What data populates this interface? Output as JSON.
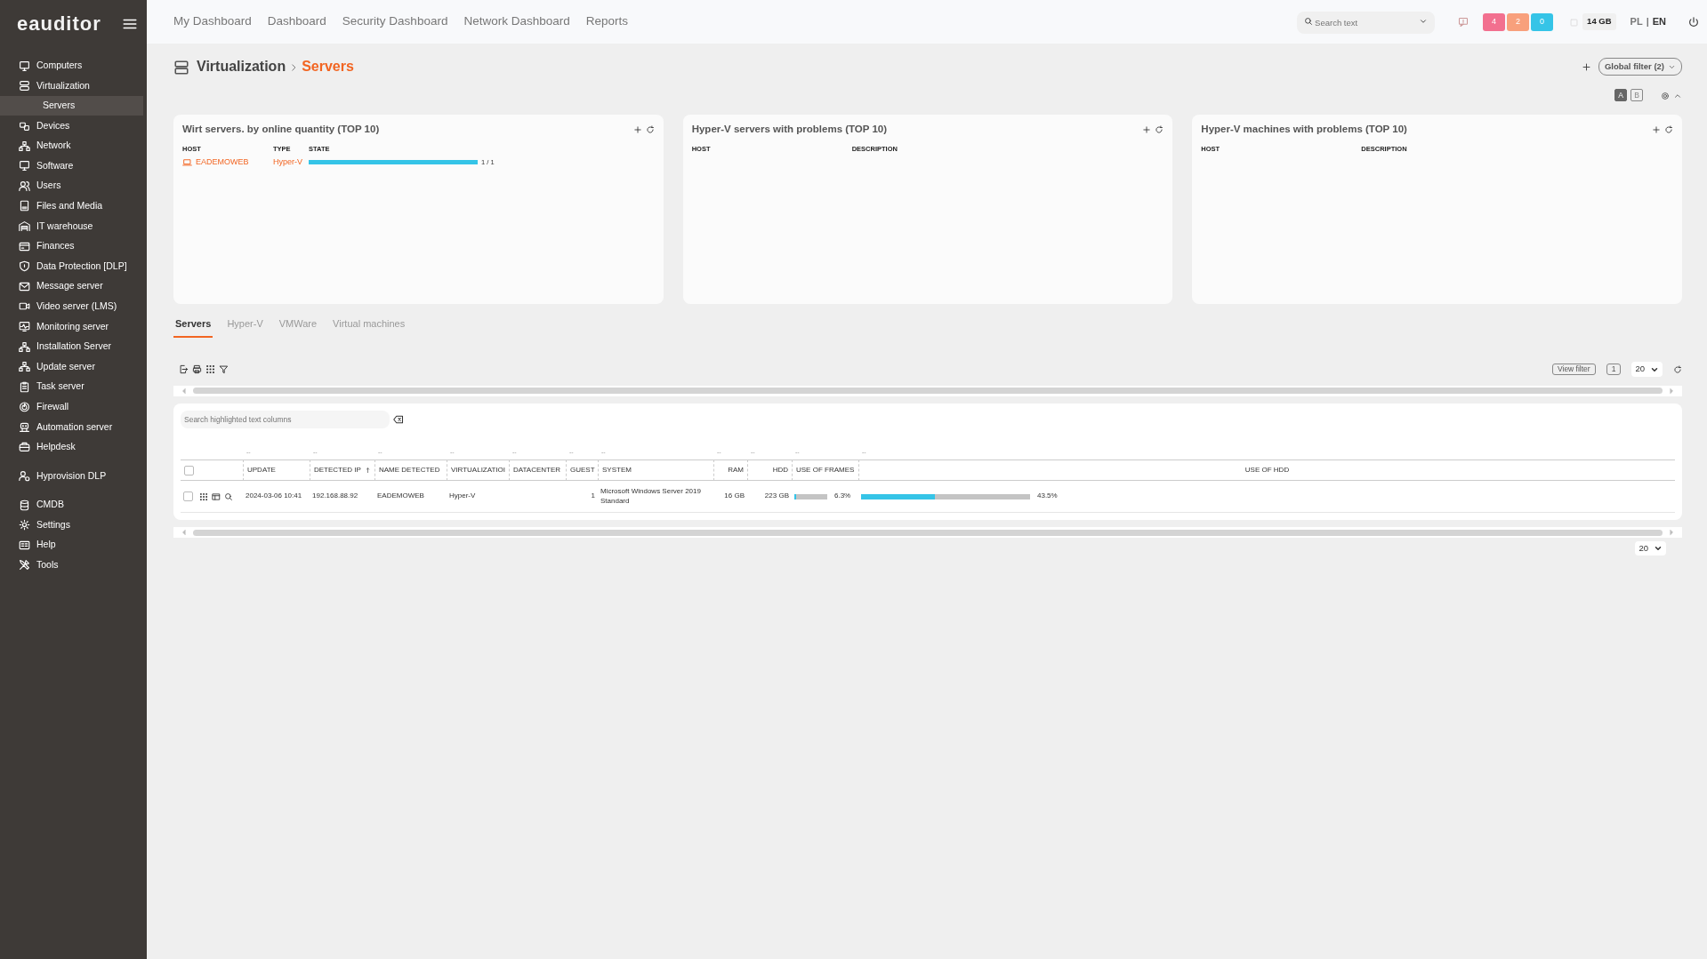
{
  "sidebar": {
    "logo": "eauditor",
    "sections": [
      {
        "items": [
          {
            "label": "Computers"
          },
          {
            "label": "Virtualization",
            "children": [
              {
                "label": "Servers",
                "selected": true
              }
            ]
          },
          {
            "label": "Devices"
          },
          {
            "label": "Network"
          },
          {
            "label": "Software"
          },
          {
            "label": "Users"
          },
          {
            "label": "Files and Media"
          },
          {
            "label": "IT warehouse"
          },
          {
            "label": "Finances"
          },
          {
            "label": "Data Protection [DLP]"
          },
          {
            "label": "Message server"
          },
          {
            "label": "Video server (LMS)"
          },
          {
            "label": "Monitoring server"
          },
          {
            "label": "Installation Server"
          },
          {
            "label": "Update server"
          },
          {
            "label": "Task server"
          },
          {
            "label": "Firewall"
          },
          {
            "label": "Automation server"
          },
          {
            "label": "Helpdesk"
          }
        ]
      },
      {
        "items": [
          {
            "label": "Hyprovision DLP"
          }
        ]
      },
      {
        "items": [
          {
            "label": "CMDB"
          },
          {
            "label": "Settings"
          },
          {
            "label": "Help"
          },
          {
            "label": "Tools"
          }
        ]
      }
    ]
  },
  "top_nav": {
    "links": [
      "My Dashboard",
      "Dashboard",
      "Security Dashboard",
      "Network Dashboard",
      "Reports"
    ],
    "search": {
      "placeholder": "Search text"
    },
    "alerts": [
      {
        "count": "4",
        "color": "#f2708f"
      },
      {
        "count": "2",
        "color": "#f8a07c"
      },
      {
        "count": "0",
        "color": "#35c4e7"
      }
    ],
    "memory": "14 GB",
    "languages": [
      {
        "code": "PL",
        "selected": false
      },
      {
        "code": "EN",
        "selected": true
      }
    ],
    "language_separator": "|"
  },
  "breadcrumb": [
    "Virtualization",
    "Servers"
  ],
  "global_filter": "Global filter (2)",
  "layout_toggle": [
    {
      "label": "A",
      "selected": true
    },
    {
      "label": "B",
      "selected": false
    }
  ],
  "widgets": [
    {
      "title": "Wirt servers. by online quantity (TOP 10)",
      "columns": [
        "HOST",
        "TYPE",
        "STATE"
      ],
      "rows": [
        {
          "host": "EADEMOWEB",
          "type": "Hyper-V",
          "level": 1.0,
          "reading": "1 / 1"
        }
      ]
    },
    {
      "title": "Hyper-V servers with problems (TOP 10)",
      "columns": [
        "HOST",
        "DESCRIPTION"
      ]
    },
    {
      "title": "Hyper-V machines with problems (TOP 10)",
      "columns": [
        "HOST",
        "DESCRIPTION"
      ]
    }
  ],
  "tabs": [
    {
      "label": "Servers",
      "selected": true
    },
    {
      "label": "Hyper-V",
      "selected": false
    },
    {
      "label": "VMWare",
      "selected": false
    },
    {
      "label": "Virtual machines",
      "selected": false
    }
  ],
  "toolbar": {
    "view_filter": "View filter",
    "page": "1",
    "page_size": "20"
  },
  "table": {
    "search": {
      "placeholder": "Search highlighted text columns"
    },
    "header_checked": false,
    "columns": [
      {
        "label": "UPDATE",
        "filter": "--",
        "sorted": false
      },
      {
        "label": "DETECTED IP",
        "filter": "--",
        "sorted": true
      },
      {
        "label": "NAME DETECTED",
        "filter": "--",
        "sorted": false
      },
      {
        "label": "VIRTUALIZATIOI",
        "filter": "--",
        "sorted": false
      },
      {
        "label": "DATACENTER",
        "filter": "--",
        "sorted": false
      },
      {
        "label": "GUEST",
        "filter": "--",
        "sorted": false
      },
      {
        "label": "SYSTEM",
        "filter": "--",
        "sorted": false
      },
      {
        "label": "RAM",
        "filter": "--",
        "sorted": false
      },
      {
        "label": "HDD",
        "filter": "--",
        "sorted": false
      },
      {
        "label": "USE OF FRAMES",
        "filter": "--",
        "sorted": false
      },
      {
        "label": "USE OF HDD",
        "filter": "--",
        "sorted": false
      }
    ],
    "rows": [
      {
        "checked": false,
        "cells": [
          "2024-03-06 10:41",
          "192.168.88.92",
          "EADEMOWEB",
          "Hyper-V",
          "",
          "1",
          "Microsoft Windows Server 2019 Standard",
          "16 GB",
          "223 GB"
        ],
        "frames": {
          "level": 0.063,
          "reading": "6.3%"
        },
        "hdd": {
          "level": 0.435,
          "reading": "43.5%"
        }
      }
    ]
  },
  "footer": {
    "page_size": "20"
  }
}
